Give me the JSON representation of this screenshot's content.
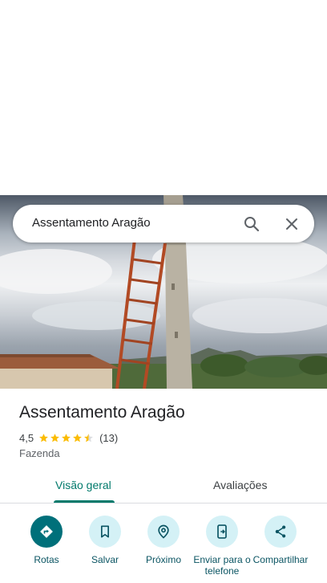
{
  "search": {
    "query": "Assentamento Aragão"
  },
  "place": {
    "title": "Assentamento Aragão",
    "rating": "4,5",
    "review_count": "(13)",
    "stars": 4.5,
    "category": "Fazenda"
  },
  "tabs": [
    {
      "label": "Visão geral",
      "active": true
    },
    {
      "label": "Avaliações",
      "active": false
    }
  ],
  "actions": [
    {
      "label": "Rotas",
      "icon": "directions-icon"
    },
    {
      "label": "Salvar",
      "icon": "bookmark-icon"
    },
    {
      "label": "Próximo",
      "icon": "nearby-icon"
    },
    {
      "label": "Enviar para o telefone",
      "icon": "send-to-phone-icon"
    },
    {
      "label": "Compartilhar",
      "icon": "share-icon"
    }
  ],
  "colors": {
    "accent": "#00796b",
    "primary_action": "#00707a",
    "action_bg": "#d4f1f6",
    "star": "#fbbc04"
  }
}
